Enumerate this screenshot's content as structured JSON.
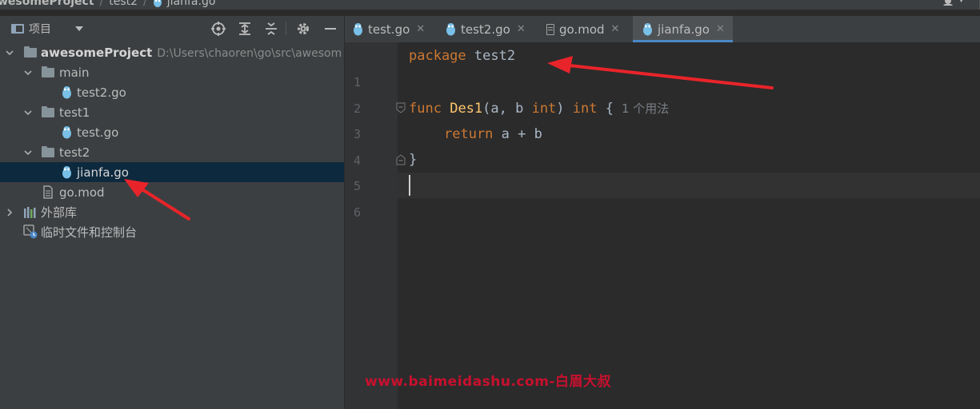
{
  "breadcrumb": {
    "items": [
      "wesomeProject",
      "test2",
      "jianfa.go"
    ]
  },
  "project_panel": {
    "title": "项目",
    "tree": [
      {
        "label": "awesomeProject",
        "path": "D:\\Users\\chaoren\\go\\src\\awesom",
        "type": "project-folder",
        "expanded": true
      },
      {
        "label": "main",
        "type": "folder",
        "expanded": true
      },
      {
        "label": "test2.go",
        "type": "go-file"
      },
      {
        "label": "test1",
        "type": "folder",
        "expanded": true
      },
      {
        "label": "test.go",
        "type": "go-file"
      },
      {
        "label": "test2",
        "type": "folder",
        "expanded": true
      },
      {
        "label": "jianfa.go",
        "type": "go-file",
        "selected": true
      },
      {
        "label": "go.mod",
        "type": "mod-file"
      },
      {
        "label": "外部库",
        "type": "library",
        "expanded": false
      },
      {
        "label": "临时文件和控制台",
        "type": "scratches"
      }
    ]
  },
  "editor": {
    "tabs": [
      {
        "label": "test.go",
        "icon": "gopher-icon"
      },
      {
        "label": "test2.go",
        "icon": "gopher-icon"
      },
      {
        "label": "go.mod",
        "icon": "file-icon"
      },
      {
        "label": "jianfa.go",
        "icon": "gopher-icon",
        "active": true
      }
    ],
    "line_numbers": [
      "1",
      "2",
      "3",
      "4",
      "5",
      "6"
    ],
    "code": {
      "line1": {
        "kw": "package",
        "name": "test2"
      },
      "line3": {
        "kw": "func",
        "fn": "Des1",
        "open": "(a, b ",
        "type1": "int",
        "close": ") ",
        "type2": "int",
        "brace": " {",
        "usage_hint": "1 个用法"
      },
      "line4": {
        "kw": "return",
        "expr": " a + b"
      },
      "line5": {
        "brace": "}"
      }
    }
  },
  "watermark": "www.baimeidashu.com-白眉大叔",
  "colors": {
    "keyword": "#cc7832",
    "function": "#ffc66d",
    "annotation_arrow": "#e8242a",
    "selection": "#0d293e"
  }
}
